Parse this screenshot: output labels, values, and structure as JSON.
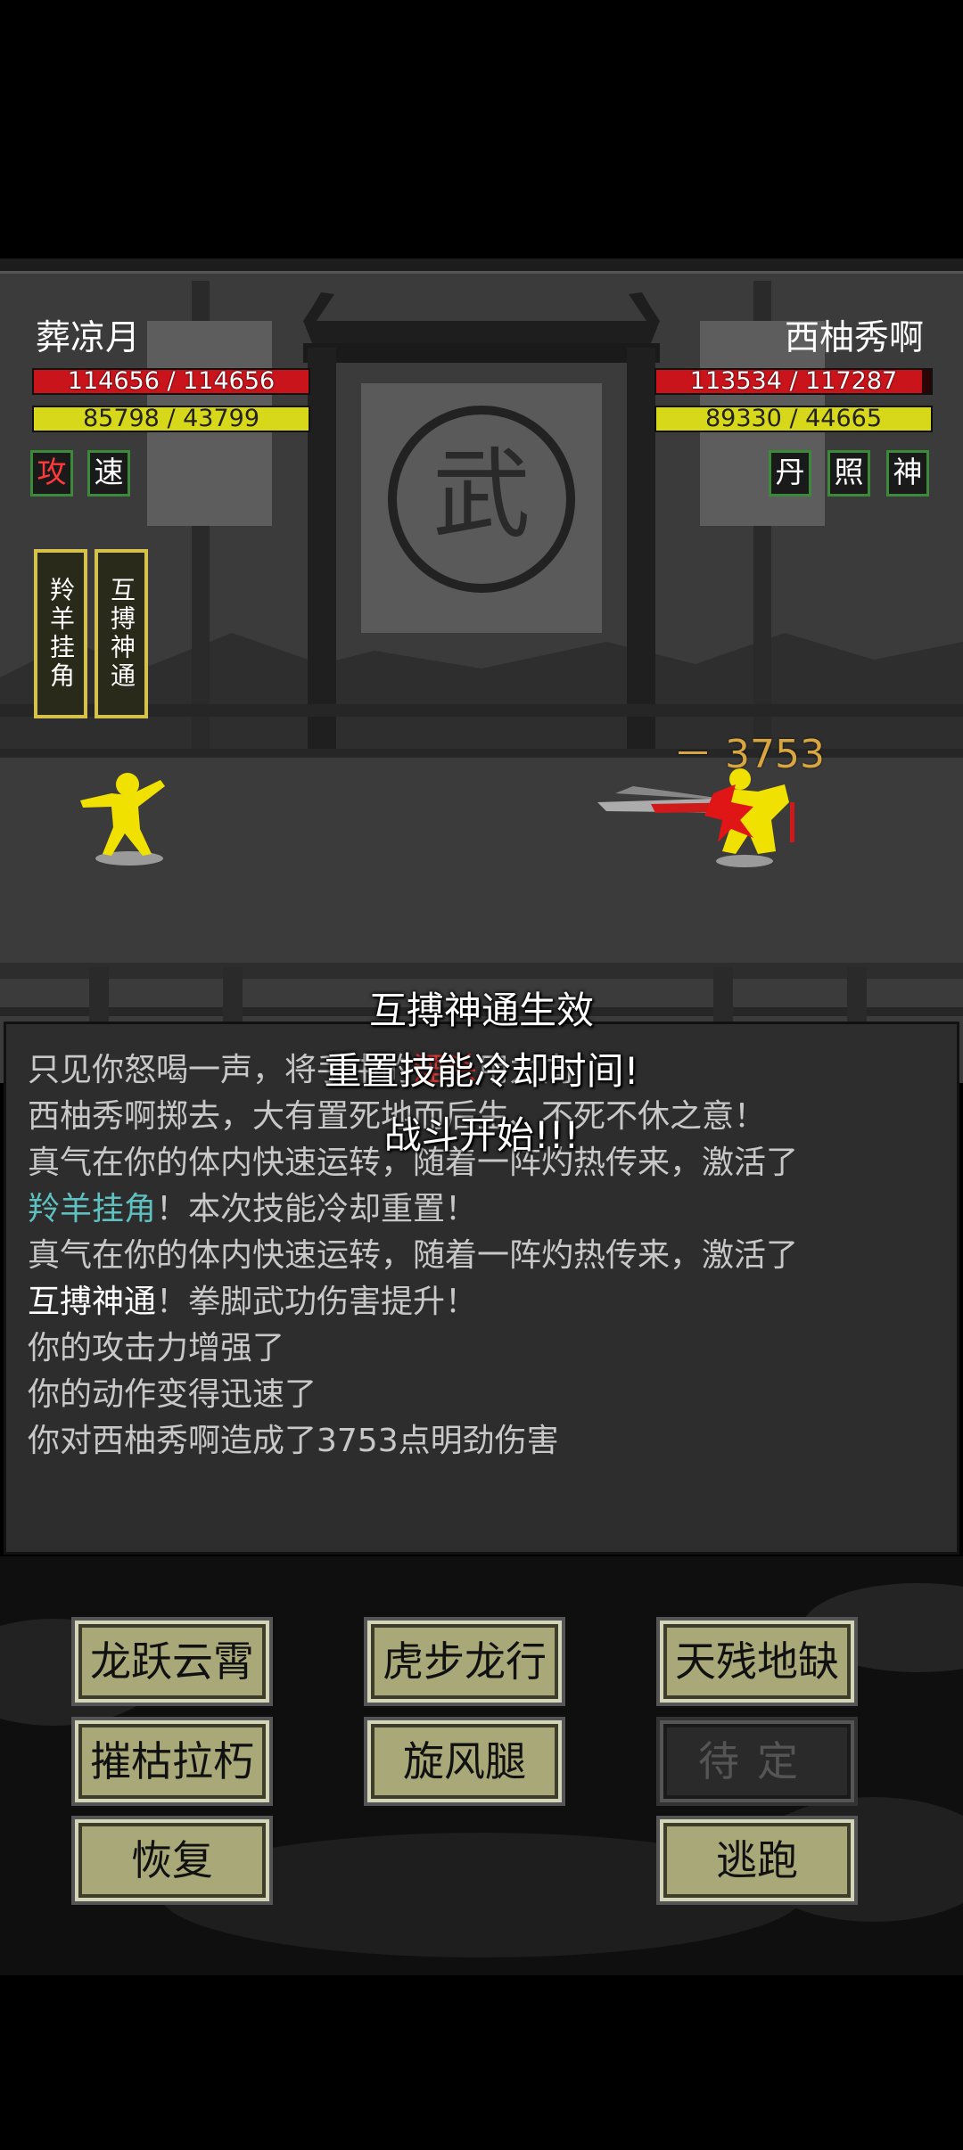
{
  "player": {
    "name": "葬凉月",
    "hp_text": "114656 / 114656",
    "hp_fraction": 1.0,
    "mp_text": "85798 / 43799",
    "mp_fraction": 1.0,
    "buffs": [
      "攻",
      "速"
    ],
    "active_skills": [
      "羚羊挂角",
      "互搏神通"
    ]
  },
  "enemy": {
    "name": "西柚秀啊",
    "hp_text": "113534 / 117287",
    "hp_fraction": 0.968,
    "mp_text": "89330 / 44665",
    "mp_fraction": 1.0,
    "buffs": [
      "丹",
      "照",
      "神"
    ]
  },
  "scene": {
    "gate_emblem": "武",
    "damage_popup": "－ 3753"
  },
  "overlay": {
    "line1": "互搏神通生效",
    "line2": "重置技能冷却时间!",
    "line3": "战斗开始!!!"
  },
  "log": {
    "line1_pre": "只见你怒喝一声，将手中的",
    "line1_weapon": "湮杀",
    "line1_post": "用力向",
    "line2": "西柚秀啊掷去，大有置死地而后生、不死不休之意！",
    "line3": "真气在你的体内快速运转，随着一阵灼热传来，激活了",
    "line4_skill": "羚羊挂角",
    "line4_post": "！本次技能冷却重置！",
    "line5": "真气在你的体内快速运转，随着一阵灼热传来，激活了",
    "line6_skill": "互搏神通",
    "line6_post": "！拳脚武功伤害提升！",
    "line7": "你的攻击力增强了",
    "line8": "你的动作变得迅速了",
    "line9": "你对西柚秀啊造成了3753点明劲伤害"
  },
  "actions": {
    "skill1": "龙跃云霄",
    "skill2": "虎步龙行",
    "skill3": "天残地缺",
    "skill4": "摧枯拉朽",
    "skill5": "旋风腿",
    "skill6": "待定",
    "recover": "恢复",
    "escape": "逃跑"
  },
  "colors": {
    "hp": "#c9141b",
    "mp": "#d8d81a",
    "fighter": "#f0e100",
    "button": "#a8a878"
  }
}
